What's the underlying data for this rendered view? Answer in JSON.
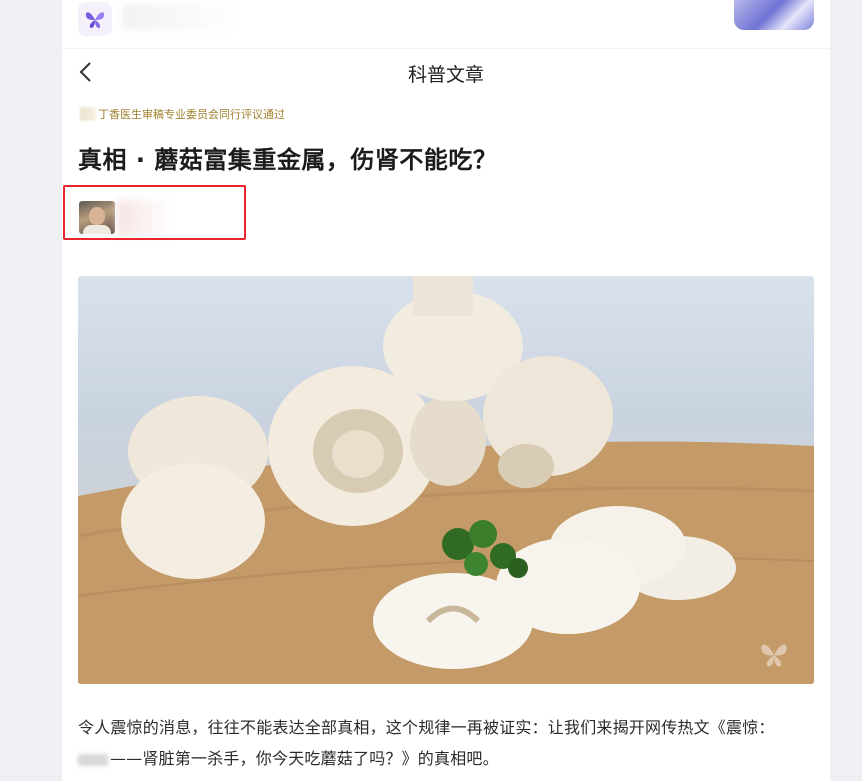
{
  "nav": {
    "title": "科普文章"
  },
  "review": {
    "text": "丁香医生审稿专业委员会同行评议通过"
  },
  "article": {
    "title": "真相 · 蘑菇富集重金属，伤肾不能吃？",
    "paragraph_line1": "令人震惊的消息，往往不能表达全部真相，这个规律一再被证实：让我们来揭开网传热文《震惊：",
    "paragraph_line2": "——肾脏第一杀手，你今天吃蘑菇了吗？》的真相吧。"
  },
  "colors": {
    "highlight_box": "#e8242c",
    "review_text": "#a0812f",
    "logo_purple": "#7b5be0"
  },
  "icons": {
    "logo": "butterfly-logo-icon",
    "back": "chevron-left-icon",
    "watermark": "butterfly-watermark-icon"
  }
}
